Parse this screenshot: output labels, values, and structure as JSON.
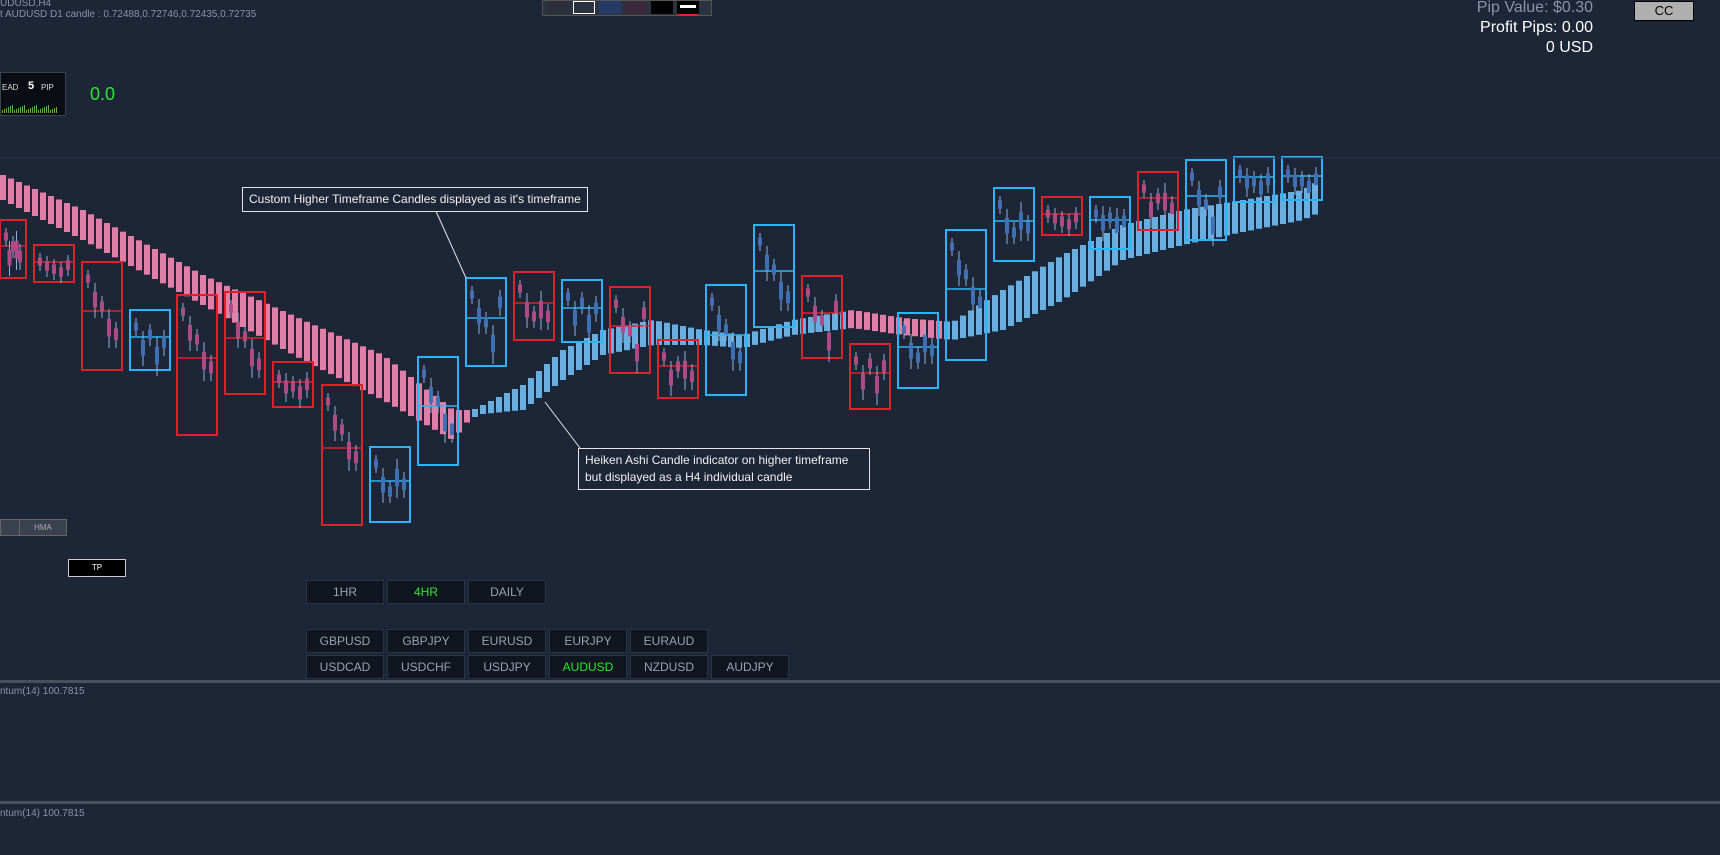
{
  "header": {
    "symbol_title": "UDUSD,H4",
    "candle_info": "t AUDUSD D1 candle : 0.72488,0.72746,0.72435,0.72735"
  },
  "swatches": [
    "#2a2f3a",
    "#1c2637",
    "#263a66",
    "#3a2a3c",
    "#000000",
    "#ffffff"
  ],
  "stats": {
    "pip_value": "Pip Value: $0.30",
    "profit_pips": "Profit Pips: 0.00",
    "usd": "0 USD",
    "cc_button": "CC"
  },
  "spread_panel": {
    "label": "EAD",
    "value": "5",
    "unit": "PIP",
    "readout": "0.0"
  },
  "side_buttons": {
    "hma": "HMA",
    "tp": "TP"
  },
  "callouts": {
    "top": "Custom Higher Timeframe Candles displayed as it's timeframe",
    "bottom_line1": "Heiken Ashi Candle indicator on higher timeframe",
    "bottom_line2": "but displayed as a H4 individual candle"
  },
  "timeframes": [
    {
      "label": "1HR",
      "active": false
    },
    {
      "label": "4HR",
      "active": true
    },
    {
      "label": "DAILY",
      "active": false
    }
  ],
  "pairs_row1": [
    {
      "label": "GBPUSD",
      "active": false
    },
    {
      "label": "GBPJPY",
      "active": false
    },
    {
      "label": "EURUSD",
      "active": false
    },
    {
      "label": "EURJPY",
      "active": false
    },
    {
      "label": "EURAUD",
      "active": false
    }
  ],
  "pairs_row2": [
    {
      "label": "USDCAD",
      "active": false
    },
    {
      "label": "USDCHF",
      "active": false
    },
    {
      "label": "USDJPY",
      "active": false
    },
    {
      "label": "AUDUSD",
      "active": true
    },
    {
      "label": "NZDUSD",
      "active": false
    },
    {
      "label": "AUDJPY",
      "active": false
    }
  ],
  "subwindows": [
    {
      "label": "ntum(14) 100.7815"
    },
    {
      "label": "ntum(14) 100.7815"
    }
  ],
  "colors": {
    "bullish_box": "#29b6f6",
    "bearish_box": "#e0202a",
    "ha_bear": "#e07fa8",
    "ha_bull": "#6aaee0",
    "candle_bull": "#3f6fb5",
    "candle_bear": "#b04a85",
    "active_text": "#2ee62e"
  }
}
